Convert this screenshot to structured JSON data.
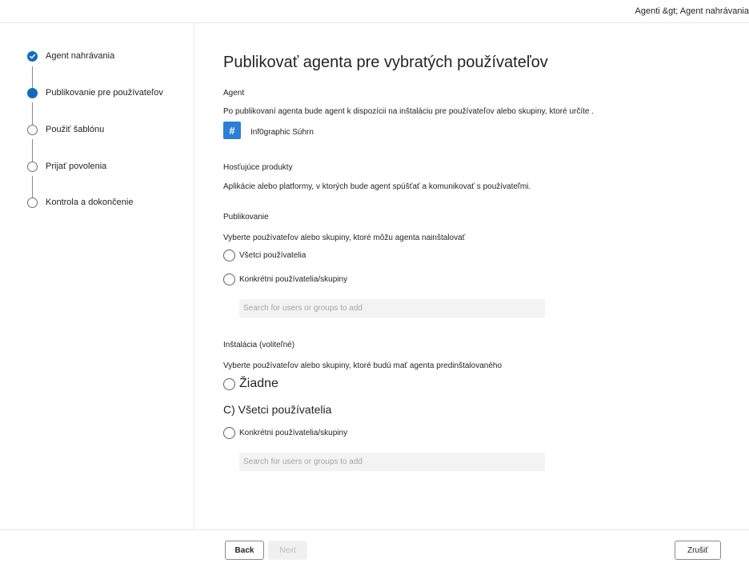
{
  "header": {
    "breadcrumb": "Agenti &gt; Agent nahrávania"
  },
  "steps": [
    {
      "label": "Agent nahrávania",
      "state": "done"
    },
    {
      "label": "Publikovanie pre používateľov",
      "state": "current"
    },
    {
      "label": "Použiť šablónu",
      "state": "pending"
    },
    {
      "label": "Prijať povolenia",
      "state": "pending"
    },
    {
      "label": "Kontrola a dokončenie",
      "state": "pending"
    }
  ],
  "main": {
    "title": "Publikovať agenta pre vybratých používateľov",
    "agent": {
      "section_label": "Agent",
      "description": "Po publikovaní agenta bude agent k dispozícii na inštaláciu pre používateľov alebo skupiny, ktoré určíte .",
      "icon_glyph": "#",
      "name": "Inf0graphic Súhrn"
    },
    "hosting": {
      "section_label": "Hosťujúce produkty",
      "description": "Aplikácie alebo platformy, v ktorých bude agent spúšťať a komunikovať s používateľmi."
    },
    "publishing": {
      "section_label": "Publikovanie",
      "description": "Vyberte používateľov alebo skupiny, ktoré môžu agenta nainštalovať",
      "option_all": "Všetci používatelia",
      "option_specific": "Konkrétni používatelia/skupiny",
      "search_placeholder": "Search for users or groups to add"
    },
    "install": {
      "section_label": "Inštalácia (voliteľné)",
      "description": "Vyberte používateľov alebo skupiny, ktoré budú mať agenta predinštalovaného",
      "option_none": "Žiadne",
      "option_all": "C) Všetci používatelia",
      "option_specific": "Konkrétni používatelia/skupiny",
      "search_placeholder": "Search for users or groups to add"
    }
  },
  "footer": {
    "back_label": "Back",
    "next_label": "Next",
    "cancel_label": "Zrušiť"
  },
  "colors": {
    "accent": "#0f6cbd",
    "agent_chip": "#2b7fd6"
  }
}
